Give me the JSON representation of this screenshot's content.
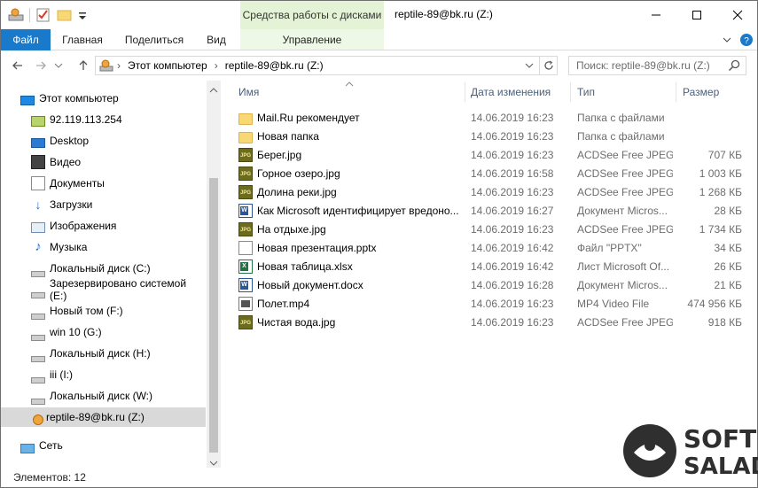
{
  "window": {
    "ribbon_context_header": "Средства работы с дисками",
    "title": "reptile-89@bk.ru (Z:)"
  },
  "ribbon": {
    "tabs": [
      {
        "label": "Файл"
      },
      {
        "label": "Главная"
      },
      {
        "label": "Поделиться"
      },
      {
        "label": "Вид"
      }
    ],
    "context_tab": "Управление"
  },
  "address": {
    "path": [
      "Этот компьютер",
      "reptile-89@bk.ru (Z:)"
    ],
    "search_placeholder": "Поиск: reptile-89@bk.ru (Z:)"
  },
  "nav_pane": {
    "items": [
      {
        "label": "Этот компьютер",
        "icon": "pc-icon"
      },
      {
        "label": "92.119.113.254",
        "icon": "network-location-icon"
      },
      {
        "label": "Desktop",
        "icon": "desktop-icon"
      },
      {
        "label": "Видео",
        "icon": "video-icon"
      },
      {
        "label": "Документы",
        "icon": "documents-icon"
      },
      {
        "label": "Загрузки",
        "icon": "downloads-icon"
      },
      {
        "label": "Изображения",
        "icon": "pictures-icon"
      },
      {
        "label": "Музыка",
        "icon": "music-icon"
      },
      {
        "label": "Локальный диск (C:)",
        "icon": "drive-icon"
      },
      {
        "label": "Зарезервировано системой (E:)",
        "icon": "drive-icon"
      },
      {
        "label": "Новый том (F:)",
        "icon": "drive-icon"
      },
      {
        "label": "win 10 (G:)",
        "icon": "drive-icon"
      },
      {
        "label": "Локальный диск (H:)",
        "icon": "drive-icon"
      },
      {
        "label": "iii (I:)",
        "icon": "drive-icon"
      },
      {
        "label": "Локальный диск (W:)",
        "icon": "drive-icon"
      },
      {
        "label": "reptile-89@bk.ru (Z:)",
        "icon": "network-drive-icon",
        "selected": true
      },
      {
        "label": "Сеть",
        "icon": "network-icon"
      }
    ]
  },
  "columns": {
    "name": "Имя",
    "date": "Дата изменения",
    "type": "Тип",
    "size": "Размер"
  },
  "files": [
    {
      "name": "Mail.Ru рекомендует",
      "date": "14.06.2019 16:23",
      "type": "Папка с файлами",
      "size": "",
      "icon": "folder-icon"
    },
    {
      "name": "Новая папка",
      "date": "14.06.2019 16:23",
      "type": "Папка с файлами",
      "size": "",
      "icon": "folder-icon"
    },
    {
      "name": "Берег.jpg",
      "date": "14.06.2019 16:23",
      "type": "ACDSee Free JPEG...",
      "size": "707 КБ",
      "icon": "jpg-icon"
    },
    {
      "name": "Горное озеро.jpg",
      "date": "14.06.2019 16:58",
      "type": "ACDSee Free JPEG...",
      "size": "1 003 КБ",
      "icon": "jpg-icon"
    },
    {
      "name": "Долина реки.jpg",
      "date": "14.06.2019 16:23",
      "type": "ACDSee Free JPEG...",
      "size": "1 268 КБ",
      "icon": "jpg-icon"
    },
    {
      "name": "Как Microsoft идентифицирует вредоно...",
      "date": "14.06.2019 16:27",
      "type": "Документ Micros...",
      "size": "28 КБ",
      "icon": "word-doc-icon"
    },
    {
      "name": "На отдыхе.jpg",
      "date": "14.06.2019 16:23",
      "type": "ACDSee Free JPEG...",
      "size": "1 734 КБ",
      "icon": "jpg-icon"
    },
    {
      "name": "Новая презентация.pptx",
      "date": "14.06.2019 16:42",
      "type": "Файл \"PPTX\"",
      "size": "34 КБ",
      "icon": "pptx-icon"
    },
    {
      "name": "Новая таблица.xlsx",
      "date": "14.06.2019 16:42",
      "type": "Лист Microsoft Of...",
      "size": "26 КБ",
      "icon": "excel-icon"
    },
    {
      "name": "Новый документ.docx",
      "date": "14.06.2019 16:28",
      "type": "Документ Micros...",
      "size": "21 КБ",
      "icon": "word-doc-icon"
    },
    {
      "name": "Полет.mp4",
      "date": "14.06.2019 16:23",
      "type": "MP4 Video File",
      "size": "474 956 КБ",
      "icon": "video-file-icon"
    },
    {
      "name": "Чистая вода.jpg",
      "date": "14.06.2019 16:23",
      "type": "ACDSee Free JPEG...",
      "size": "918 КБ",
      "icon": "jpg-icon"
    }
  ],
  "status": {
    "items_count": "Элементов: 12"
  },
  "watermark": {
    "line1": "SOFT",
    "line2": "SALAD"
  },
  "colors": {
    "accent": "#1979ca",
    "context_tab": "#e4f3d6",
    "selection": "#d9d9d9",
    "header_text": "#4c607a"
  }
}
